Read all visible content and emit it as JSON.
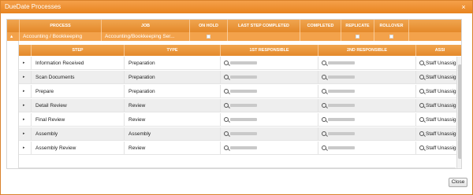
{
  "window": {
    "title": "DueDate Processes",
    "close_glyph": "×"
  },
  "outer_table": {
    "columns": [
      "PROCESS",
      "JOB",
      "ON HOLD",
      "LAST STEP COMPLETED",
      "COMPLETED",
      "REPLICATE",
      "ROLLOVER"
    ],
    "row": {
      "expander": "▴",
      "process": "Accounting / Bookkeeping",
      "job": "Accounting/Bookkeeping Ser...",
      "last_step_completed": "",
      "completed": ""
    }
  },
  "inner_table": {
    "columns": [
      "STEP",
      "TYPE",
      "1ST RESPONSIBLE",
      "2ND RESPONSIBLE",
      "ASSI"
    ],
    "rows": [
      {
        "step": "Information Received",
        "type": "Preparation",
        "third": "Staff Unassigne"
      },
      {
        "step": "Scan Documents",
        "type": "Preparation",
        "third": "Staff Unassigne"
      },
      {
        "step": "Prepare",
        "type": "Preparation",
        "third": "Staff Unassigne"
      },
      {
        "step": "Detail Review",
        "type": "Review",
        "third": "Staff Unassigne"
      },
      {
        "step": "Final Review",
        "type": "Review",
        "third": "Staff Unassigne"
      },
      {
        "step": "Assembly",
        "type": "Assembly",
        "third": "Staff Unassigne"
      },
      {
        "step": "Assembly Review",
        "type": "Review",
        "third": "Staff Unassigne"
      }
    ]
  },
  "footer": {
    "close_label": "Close"
  }
}
